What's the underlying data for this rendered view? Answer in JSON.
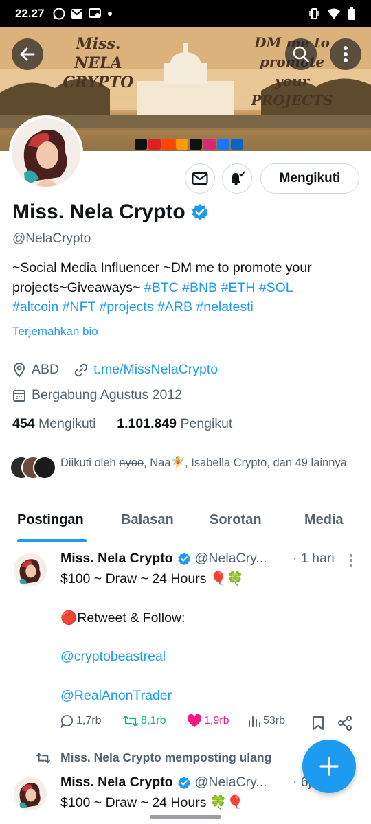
{
  "status_bar": {
    "time": "22.27"
  },
  "banner": {
    "left_text": "Miss. NELA\nCRYPTO",
    "right_text": "DM me to promote\nyour PROJECTS",
    "socials_colors": [
      "#111111",
      "#e02020",
      "#ff4500",
      "#ff9900",
      "#111111",
      "#d62976",
      "#1877f2",
      "#0a66c2"
    ]
  },
  "profile": {
    "name": "Miss. Nela Crypto",
    "handle": "@NelaCrypto",
    "follow_button": "Mengikuti",
    "bio_plain": "~Social Media Influencer ~DM me to promote your projects~Giveaways~ ",
    "bio_tags": [
      "#BTC",
      "#BNB",
      "#ETH",
      "#SOL",
      "#altcoin",
      "#NFT",
      "#projects",
      "#ARB",
      "#nelatesti"
    ],
    "translate_bio": "Terjemahkan bio",
    "location": "ABD",
    "link": "t.me/MissNelaCrypto",
    "joined": "Bergabung Agustus 2012",
    "following_count": "454",
    "following_label": "Mengikuti",
    "followers_count": "1.101.849",
    "followers_label": "Pengikut",
    "followed_by": {
      "prefix": "Diikuti oleh ",
      "user1": "nyoo",
      "sep1": ", ",
      "user2": "Naa🧚",
      "sep2": ", ",
      "user3": "Isabella Crypto",
      "suffix": ", dan 49 lainnya"
    }
  },
  "tabs": [
    "Postingan",
    "Balasan",
    "Sorotan",
    "Media"
  ],
  "tweet1": {
    "name": "Miss. Nela Crypto",
    "handle": "@NelaCry...",
    "time": "· 1 hari",
    "line1": "$100 ~ Draw ~ 24 Hours 🎈🍀",
    "line2": "🔴Retweet & Follow:",
    "mention1": "@cryptobeastreal",
    "mention2": "@RealAnonTrader",
    "replies": "1,7rb",
    "retweets": "8,1rb",
    "likes": "1,9rb",
    "views": "53rb"
  },
  "repost_label": "Miss. Nela Crypto memposting ulang",
  "tweet2": {
    "name": "Miss. Nela Crypto",
    "handle": "@NelaCry...",
    "time": "· 6j",
    "line1": "$100 ~ Draw ~ 24 Hours 🍀🎈"
  },
  "colors": {
    "accent": "#1d9bf0",
    "like": "#f91880",
    "retweet": "#00ba7c"
  }
}
